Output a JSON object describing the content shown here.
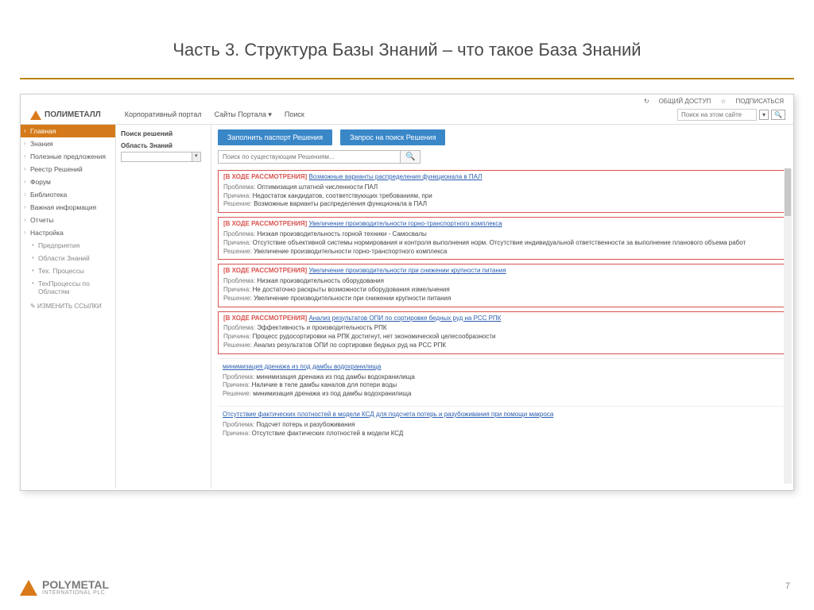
{
  "slide": {
    "title": "Часть 3. Структура Базы Знаний – что такое База Знаний",
    "page": "7"
  },
  "utility": {
    "share": "ОБЩИЙ ДОСТУП",
    "subscribe": "ПОДПИСАТЬСЯ"
  },
  "logo": {
    "text": "ПОЛИМЕТАЛЛ"
  },
  "topnav": {
    "a": "Корпоративный портал",
    "b": "Сайты Портала",
    "c": "Поиск"
  },
  "topsearch": {
    "placeholder": "Поиск на этом сайте"
  },
  "sidebar": {
    "items": [
      "Главная",
      "Знания",
      "Полезные предложения",
      "Реестр Решений",
      "Форум",
      "Библиотека",
      "Важная информация",
      "Отчеты",
      "Настройка"
    ],
    "subitems": [
      "Предприятия",
      "Области Знаний",
      "Тех. Процессы",
      "ТехПроцессы по Областям"
    ],
    "edit": "ИЗМЕНИТЬ ССЫЛКИ"
  },
  "filter": {
    "header": "Поиск решений",
    "label": "Область Знаний"
  },
  "buttons": {
    "fill": "Заполнить паспорт Решения",
    "request": "Запрос на поиск Решения"
  },
  "search": {
    "placeholder": "Поиск по существующим Решениям..."
  },
  "labels": {
    "problem": "Проблема:",
    "cause": "Причина:",
    "solution": "Решение:"
  },
  "status": "[В ХОДЕ РАССМОТРЕНИЯ]",
  "cards": [
    {
      "title": "Возможные варианты распределения функционала в ПАЛ",
      "problem": "Оптимизация штатной численности ПАЛ",
      "cause": "Недостаток кандидатов, соответствующих требованиям, при",
      "solution": "Возможные варианты распределения функционала в ПАЛ"
    },
    {
      "title": "Увеличение производительности горно-транспортного комплекса",
      "problem": "Низкая производительность горной техники - Самосвалы",
      "cause": "Отсутствие объективной системы нормирования и контроля выполнения норм. Отсутствие индивидуальной ответственности за выполнение планового объема работ",
      "solution": "Увеличение производительности горно-транспортного комплекса"
    },
    {
      "title": "Увеличение производительности при снижении крупности питания",
      "problem": "Низкая производительность оборудования",
      "cause": "Не достаточно раскрыты возможности оборудования измельчения",
      "solution": "Увеличение производительности при снижении крупности питания"
    },
    {
      "title": "Анализ результатов ОПИ по сортировке бедных руд на РСС РПК",
      "problem": "Эффективность и производительность РПК",
      "cause": "Процесс рудосортировки на РПК достигнут, нет экономической целесообразности",
      "solution": "Анализ результатов ОПИ по сортировке бедных руд на РСС РПК"
    }
  ],
  "plain_cards": [
    {
      "title": "минимизация дренажа из под дамбы водохранилища",
      "problem": "минимизация дренажа из под дамбы водохранилища",
      "cause": "Наличие в теле дамбы каналов для потери воды",
      "solution": "минимизация дренажа из под дамбы водохранилища"
    },
    {
      "title": "Отсутствие фактических плотностей в модели КСД для подсчета потерь и разубоживания при помощи макроса",
      "problem": "Подсчет потерь и разубоживания",
      "cause": "Отсутствие фактических плотностей в модели КСД"
    }
  ],
  "footer": {
    "brand": "POLYMETAL",
    "sub": "INTERNATIONAL PLC"
  }
}
